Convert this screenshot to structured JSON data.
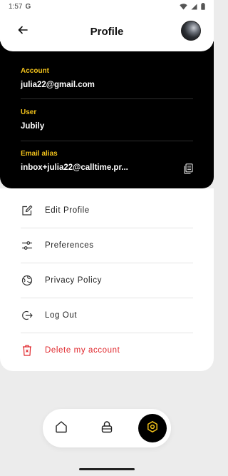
{
  "status_bar": {
    "time": "1:57",
    "carrier_glyph": "G",
    "icons": [
      "wifi-icon",
      "signal-icon",
      "battery-icon"
    ]
  },
  "header": {
    "title": "Profile",
    "back_icon": "arrow-left-icon",
    "avatar": "avatar"
  },
  "account": {
    "account_label": "Account",
    "account_value": "julia22@gmail.com",
    "user_label": "User",
    "user_value": "Jubily",
    "alias_label": "Email alias",
    "alias_value": "inbox+julia22@calltime.pr...",
    "copy_icon": "copy-icon"
  },
  "menu": {
    "items": [
      {
        "label": "Edit Profile",
        "icon": "edit-icon"
      },
      {
        "label": "Preferences",
        "icon": "sliders-icon"
      },
      {
        "label": "Privacy Policy",
        "icon": "privacy-icon"
      },
      {
        "label": "Log Out",
        "icon": "logout-icon"
      },
      {
        "label": "Delete my account",
        "icon": "trash-icon"
      }
    ]
  },
  "bottom_nav": {
    "items": [
      {
        "icon": "home-icon",
        "active": false
      },
      {
        "icon": "lock-icon",
        "active": false
      },
      {
        "icon": "settings-hex-icon",
        "active": true
      }
    ]
  },
  "colors": {
    "accent": "#f2c21b",
    "danger": "#e0262b",
    "card_dark": "#000000",
    "background": "#ececec"
  }
}
